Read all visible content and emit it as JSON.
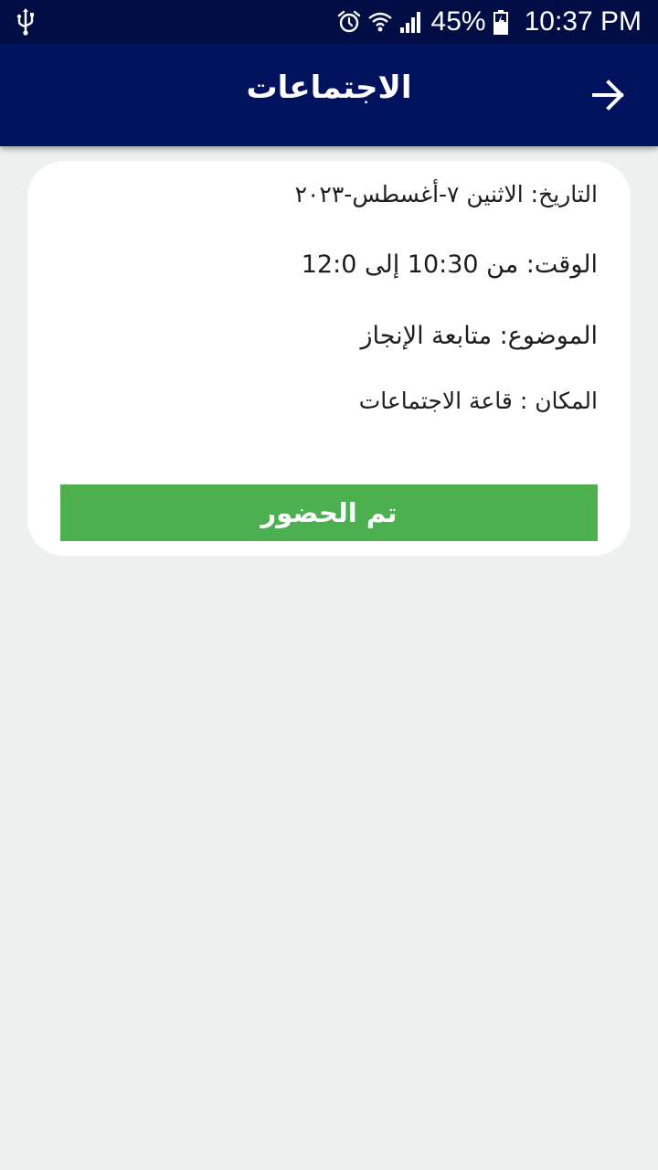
{
  "status_bar": {
    "icons": [
      "usb-icon",
      "alarm-icon",
      "wifi-icon",
      "signal-icon",
      "battery-icon"
    ],
    "battery_percent": "45%",
    "time": "10:37 PM"
  },
  "app_bar": {
    "title": "الاجتماعات",
    "back_icon": "arrow-right-icon",
    "background": "#01135e"
  },
  "meeting": {
    "date_label": "التاريخ:",
    "date_value": "الاثنين ٧-أغسطس-٢٠٢٣",
    "time_label": "الوقت:",
    "time_value": "من 10:30 إلى 12:0",
    "subject_label": "الموضوع:",
    "subject_value": "متابعة الإنجاز",
    "place_label": "المكان :",
    "place_value": "قاعة الاجتماعات",
    "attend_button": "تم الحضور",
    "attend_color": "#4cb050"
  }
}
